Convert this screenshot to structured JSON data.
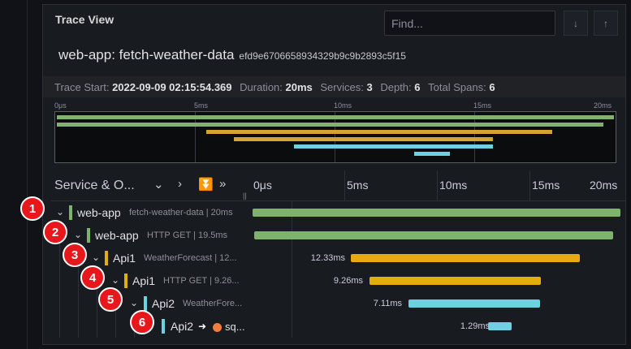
{
  "panel": {
    "title": "Trace View"
  },
  "search": {
    "placeholder": "Find..."
  },
  "nav": {
    "prev_icon": "arrow-down-icon",
    "next_icon": "arrow-up-icon",
    "prev_glyph": "↓",
    "next_glyph": "↑"
  },
  "trace": {
    "name": "web-app: fetch-weather-data",
    "id": "efd9e6706658934329b9c9b2893c5f15"
  },
  "summary": {
    "start_label": "Trace Start:",
    "start_value": "2022-09-09 02:15:54.369",
    "duration_label": "Duration:",
    "duration_value": "20ms",
    "services_label": "Services:",
    "services_value": "3",
    "depth_label": "Depth:",
    "depth_value": "6",
    "spans_label": "Total Spans:",
    "spans_value": "6"
  },
  "minimap_ticks": [
    "0μs",
    "5ms",
    "10ms",
    "15ms",
    "20ms"
  ],
  "timeline_ticks": [
    "0μs",
    "5ms",
    "10ms",
    "15ms",
    "20ms"
  ],
  "columns": {
    "service_header": "Service & O...",
    "split_glyph": "||"
  },
  "colors": {
    "green": "#7eb26d",
    "yellow": "#e5ac0e",
    "gold": "#d6a32d",
    "cyan": "#6ed0e0",
    "badge": "#e8171b"
  },
  "spans": [
    {
      "badge": "1",
      "service": "web-app",
      "operation": "fetch-weather-data | 20ms",
      "duration": "",
      "color": "#7eb26d",
      "depth": 0
    },
    {
      "badge": "2",
      "service": "web-app",
      "operation": "HTTP GET | 19.5ms",
      "duration": "",
      "color": "#7eb26d",
      "depth": 1
    },
    {
      "badge": "3",
      "service": "Api1",
      "operation": "WeatherForecast | 12...",
      "duration": "12.33ms",
      "color": "#e5ac0e",
      "depth": 2
    },
    {
      "badge": "4",
      "service": "Api1",
      "operation": "HTTP GET | 9.26...",
      "duration": "9.26ms",
      "color": "#e5ac0e",
      "depth": 3
    },
    {
      "badge": "5",
      "service": "Api2",
      "operation": "WeatherFore...",
      "duration": "7.11ms",
      "color": "#6ed0e0",
      "depth": 4
    },
    {
      "badge": "6",
      "service": "Api2",
      "operation": "sq...",
      "duration": "1.29ms",
      "color": "#6ed0e0",
      "depth": 5
    }
  ]
}
